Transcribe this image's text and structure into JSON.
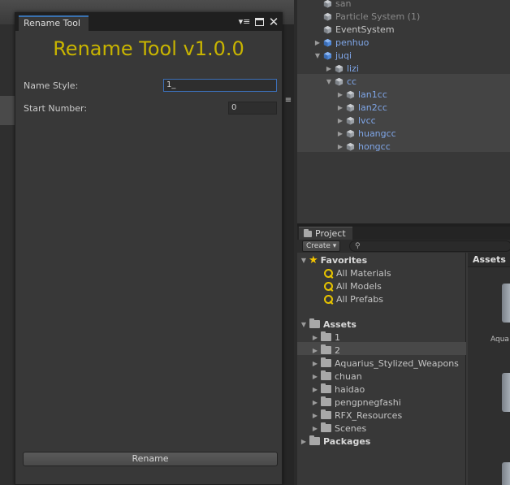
{
  "rename_tool": {
    "tab_title": "Rename Tool",
    "heading": "Rename Tool v1.0.0",
    "name_style_label": "Name Style:",
    "name_style_value": "1_",
    "start_number_label": "Start Number:",
    "start_number_value": "0",
    "rename_button": "Rename",
    "title_color": "#c8b400"
  },
  "hierarchy": {
    "items": [
      {
        "label": "san",
        "indent": 1,
        "arrow": false,
        "style": "dim"
      },
      {
        "label": "Particle System (1)",
        "indent": 1,
        "arrow": false,
        "style": "dim"
      },
      {
        "label": "EventSystem",
        "indent": 1,
        "arrow": false,
        "style": "normal"
      },
      {
        "label": "penhuo",
        "indent": 1,
        "arrow": "collapsed",
        "style": "prefab"
      },
      {
        "label": "juqi",
        "indent": 1,
        "arrow": "expanded",
        "style": "prefab"
      },
      {
        "label": "lizi",
        "indent": 2,
        "arrow": "collapsed",
        "style": "prefab"
      },
      {
        "label": "cc",
        "indent": 2,
        "arrow": "expanded",
        "style": "prefab"
      },
      {
        "label": "lan1cc",
        "indent": 3,
        "arrow": "collapsed",
        "style": "prefab"
      },
      {
        "label": "lan2cc",
        "indent": 3,
        "arrow": "collapsed",
        "style": "prefab"
      },
      {
        "label": "lvcc",
        "indent": 3,
        "arrow": "collapsed",
        "style": "prefab"
      },
      {
        "label": "huangcc",
        "indent": 3,
        "arrow": "collapsed",
        "style": "prefab"
      },
      {
        "label": "hongcc",
        "indent": 3,
        "arrow": "collapsed",
        "style": "prefab"
      }
    ]
  },
  "project": {
    "tab_title": "Project",
    "create_label": "Create ▾",
    "favorites_label": "Favorites",
    "favorites": [
      "All Materials",
      "All Models",
      "All Prefabs"
    ],
    "assets_label": "Assets",
    "folders": [
      "1",
      "2",
      "Aquarius_Stylized_Weapons",
      "chuan",
      "haidao",
      "pengpnegfashi",
      "RFX_Resources",
      "Scenes"
    ],
    "packages_label": "Packages",
    "pane_header": "Assets",
    "pane_caption": "Aqua"
  }
}
